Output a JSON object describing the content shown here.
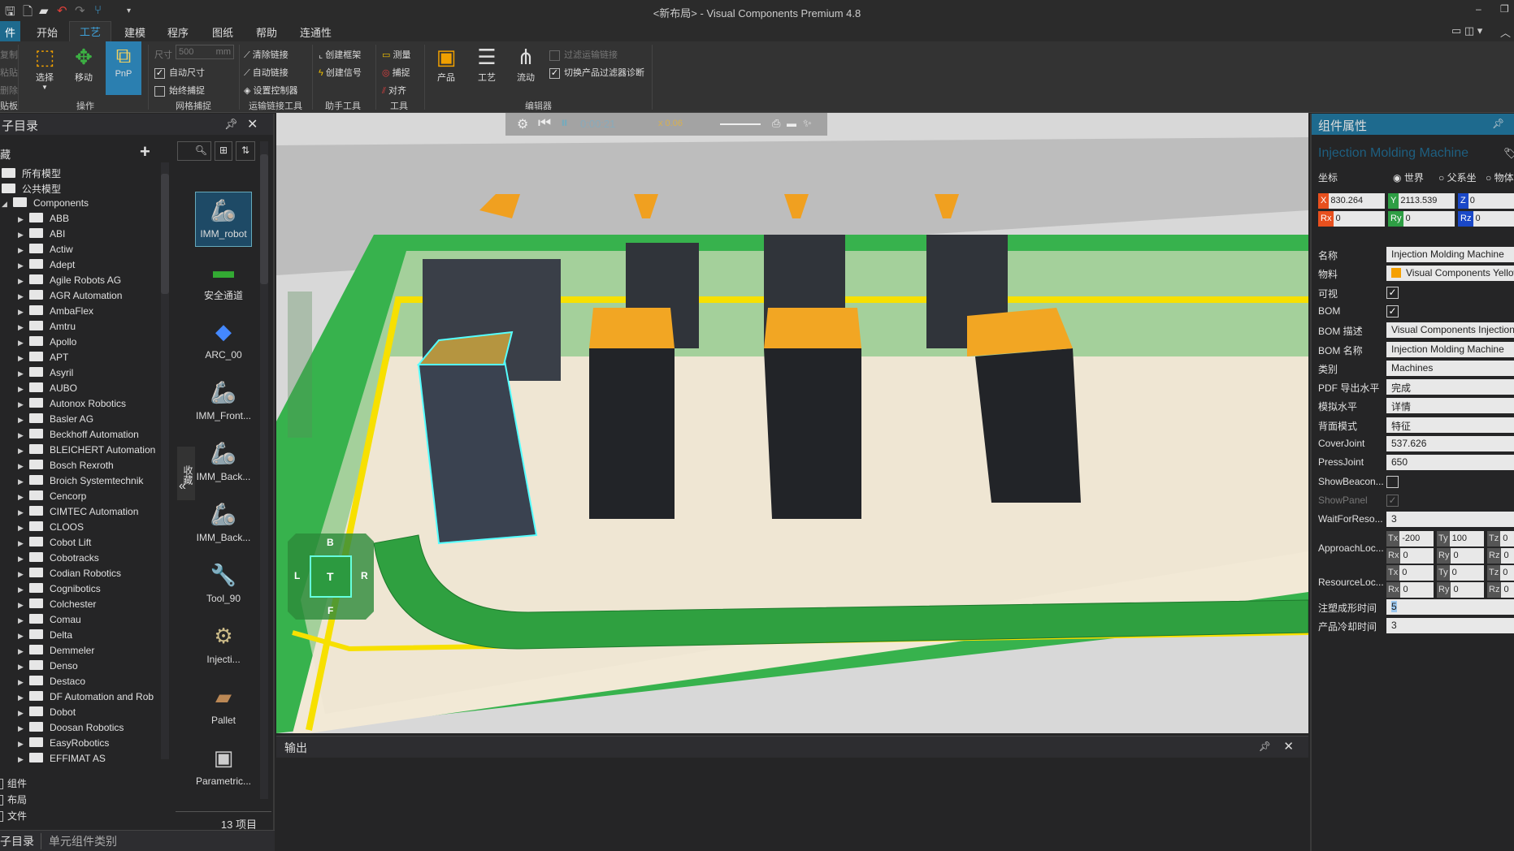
{
  "window": {
    "title": "<新布局> - Visual Components Premium 4.8"
  },
  "menu_tabs": [
    "件",
    "开始",
    "工艺",
    "建模",
    "程序",
    "图纸",
    "帮助",
    "连通性"
  ],
  "ribbon": {
    "clipboard": {
      "items": [
        "复制",
        "粘贴",
        "删除"
      ],
      "group": "贴板"
    },
    "operate": {
      "select": "选择",
      "move": "移动",
      "pnp": "PnP",
      "group": "操作"
    },
    "grid": {
      "size_label": "尺寸",
      "size_value": "500",
      "unit": "mm",
      "auto_size": "自动尺寸",
      "always_snap": "始终捕捉",
      "group": "网格捕捉"
    },
    "conveyor": {
      "clear": "清除链接",
      "auto": "自动链接",
      "controller": "设置控制器",
      "group": "运输链接工具"
    },
    "helper": {
      "frame": "创建框架",
      "signal": "创建信号",
      "group": "助手工具"
    },
    "tools": {
      "measure": "测量",
      "snap": "捕捉",
      "align": "对齐",
      "group": "工具"
    },
    "editor": {
      "product": "产品",
      "process": "工艺",
      "flow": "流动",
      "filter": "过滤运输链接",
      "toggle": "切换产品过滤器诊断",
      "group": "编辑器"
    }
  },
  "left_panel": {
    "title": "子目录",
    "favorites": "藏",
    "tree_top": [
      "所有模型",
      "公共模型",
      "Components"
    ],
    "tree": [
      "ABB",
      "ABI",
      "Actiw",
      "Adept",
      "Agile Robots AG",
      "AGR Automation",
      "AmbaFlex",
      "Amtru",
      "Apollo",
      "APT",
      "Asyril",
      "AUBO",
      "Autonox Robotics",
      "Basler AG",
      "Beckhoff Automation",
      "BLEICHERT Automation",
      "Bosch Rexroth",
      "Broich Systemtechnik",
      "Cencorp",
      "CIMTEC Automation",
      "CLOOS",
      "Cobot Lift",
      "Cobotracks",
      "Codian Robotics",
      "Cognibotics",
      "Colchester",
      "Comau",
      "Delta",
      "Demmeler",
      "Denso",
      "Destaco",
      "DF Automation and Rob",
      "Dobot",
      "Doosan Robotics",
      "EasyRobotics",
      "EFFIMAT AS"
    ],
    "filters": [
      "组件",
      "布局",
      "文件"
    ],
    "thumbs": [
      "IMM_robot",
      "安全通道",
      "ARC_00",
      "IMM_Front...",
      "IMM_Back...",
      "IMM_Back...",
      "Tool_90",
      "Injecti...",
      "Pallet",
      "Parametric..."
    ],
    "collapse_label": "收藏",
    "count": "13 项目",
    "bottom_tabs": [
      "子目录",
      "单元组件类别"
    ]
  },
  "viewport": {
    "sim_time": "0:00:21",
    "speed": "x 0.06",
    "navcube": {
      "top": "B",
      "left": "L",
      "center": "T",
      "right": "R",
      "bottom": "F"
    }
  },
  "output": {
    "title": "输出"
  },
  "props": {
    "title": "组件属性",
    "component": "Injection Molding Machine",
    "coord_label": "坐标",
    "coord_options": [
      "世界",
      "父系坐",
      "物体"
    ],
    "x": "830.264",
    "y": "2113.539",
    "z": "0",
    "rx": "0",
    "ry": "0",
    "rz": "0",
    "rows": [
      {
        "label": "名称",
        "value": "Injection Molding Machine"
      },
      {
        "label": "物料",
        "value": "Visual Components Yellow"
      },
      {
        "label": "可视",
        "check": true
      },
      {
        "label": "BOM",
        "check": true
      },
      {
        "label": "BOM 描述",
        "value": "Visual Components Injection"
      },
      {
        "label": "BOM 名称",
        "value": "Injection Molding Machine"
      },
      {
        "label": "类别",
        "value": "Machines"
      },
      {
        "label": "PDF 导出水平",
        "value": "完成"
      },
      {
        "label": "模拟水平",
        "value": "详情"
      },
      {
        "label": "背面模式",
        "value": "特征"
      },
      {
        "label": "CoverJoint",
        "value": "537.626"
      },
      {
        "label": "PressJoint",
        "value": "650"
      },
      {
        "label": "ShowBeacon...",
        "check": false
      },
      {
        "label": "ShowPanel",
        "check": true,
        "disabled": true
      },
      {
        "label": "WaitForReso...",
        "value": "3"
      }
    ],
    "approach": {
      "label": "ApproachLoc...",
      "tx": "-200",
      "ty": "100",
      "tz": "0",
      "rx": "0",
      "ry": "0",
      "rz": "0"
    },
    "resource": {
      "label": "ResourceLoc...",
      "tx": "0",
      "ty": "0",
      "tz": "0",
      "rx": "0",
      "ry": "0",
      "rz": "0"
    },
    "mold_time": {
      "label": "注塑成形时间",
      "value": "5"
    },
    "cool_time": {
      "label": "产品冷却时间",
      "value": "3"
    },
    "colors": {
      "x": "#e8501e",
      "y": "#2e9e44",
      "z": "#1a48c8",
      "material": "#f5a000",
      "accent": "#1e6a8e"
    }
  }
}
